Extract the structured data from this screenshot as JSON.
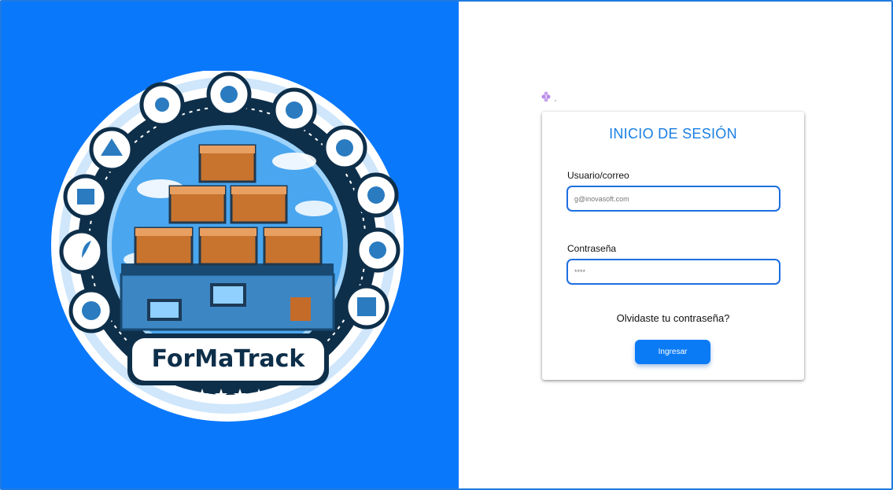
{
  "brand": {
    "logo_text": "ForMaTrack",
    "logo_icon_names": [
      "lightbulb-icon",
      "gear-icon",
      "settings-icon",
      "network-icon",
      "box-icon",
      "plant-icon",
      "globe-icon",
      "grid-icon"
    ]
  },
  "login": {
    "title": "INICIO DE SESIÓN",
    "username_label": "Usuario/correo",
    "username_placeholder": "g@inovasoft.com",
    "password_label": "Contraseña",
    "password_placeholder": "****",
    "forgot_label": "Olvidaste tu contraseña?",
    "submit_label": "Ingresar"
  },
  "colors": {
    "primary": "#0a78fb",
    "title": "#1a7fe3",
    "input_border": "#1e6fe0"
  }
}
